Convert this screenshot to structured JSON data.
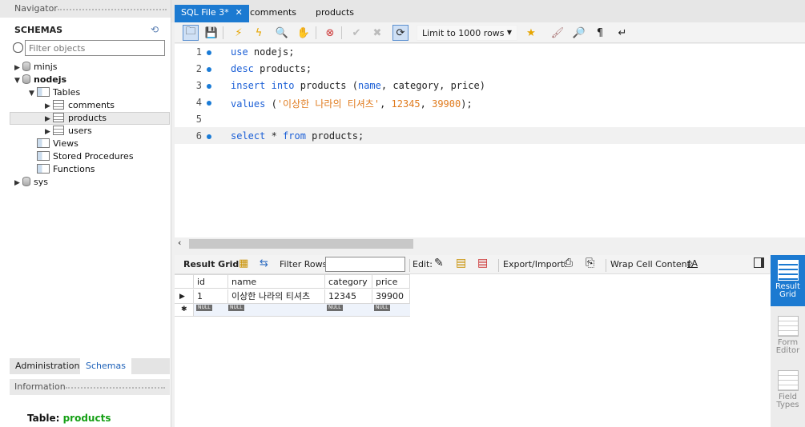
{
  "navigator": {
    "title": "Navigator",
    "schemas_title": "SCHEMAS",
    "filter_placeholder": "Filter objects",
    "tree": {
      "minjs": "minjs",
      "nodejs": "nodejs",
      "tables": "Tables",
      "comments": "comments",
      "products": "products",
      "users": "users",
      "views": "Views",
      "stored_procedures": "Stored Procedures",
      "functions": "Functions",
      "sys": "sys"
    },
    "bottom_tabs": [
      "Administration",
      "Schemas"
    ],
    "information_title": "Information",
    "table_label_prefix": "Table:",
    "table_label_name": "products"
  },
  "tabs": [
    "SQL File 3*",
    "comments",
    "products"
  ],
  "toolbar": {
    "limit": "Limit to 1000 rows"
  },
  "editor": {
    "lines": [
      {
        "n": "1",
        "code": [
          {
            "t": "use",
            "c": "kw"
          },
          {
            "t": " nodejs;",
            "c": ""
          }
        ]
      },
      {
        "n": "2",
        "code": [
          {
            "t": "desc",
            "c": "kw"
          },
          {
            "t": " products;",
            "c": ""
          }
        ]
      },
      {
        "n": "3",
        "code": [
          {
            "t": "insert",
            "c": "kw"
          },
          {
            "t": " ",
            "c": ""
          },
          {
            "t": "into",
            "c": "kw"
          },
          {
            "t": " products (",
            "c": ""
          },
          {
            "t": "name",
            "c": "kw"
          },
          {
            "t": ", category, price)",
            "c": ""
          }
        ]
      },
      {
        "n": "4",
        "code": [
          {
            "t": "values",
            "c": "kw"
          },
          {
            "t": " (",
            "c": ""
          },
          {
            "t": "'이상한 나라의 티셔츠'",
            "c": "str"
          },
          {
            "t": ", ",
            "c": ""
          },
          {
            "t": "12345",
            "c": "str"
          },
          {
            "t": ", ",
            "c": ""
          },
          {
            "t": "39900",
            "c": "str"
          },
          {
            "t": ");",
            "c": ""
          }
        ]
      },
      {
        "n": "5",
        "code": []
      },
      {
        "n": "6",
        "code": [
          {
            "t": "select",
            "c": "kw"
          },
          {
            "t": " * ",
            "c": ""
          },
          {
            "t": "from",
            "c": "kw"
          },
          {
            "t": " products;",
            "c": ""
          }
        ]
      }
    ]
  },
  "result_toolbar": {
    "result_grid": "Result Grid",
    "filter_rows": "Filter Rows:",
    "edit": "Edit:",
    "export_import": "Export/Import:",
    "wrap": "Wrap Cell Content:"
  },
  "grid": {
    "columns": [
      "id",
      "name",
      "category",
      "price"
    ],
    "rows": [
      [
        "1",
        "이상한 나라의 티셔츠",
        "12345",
        "39900"
      ]
    ],
    "null_label": "NULL"
  },
  "side_panel": [
    "Result Grid",
    "Form Editor",
    "Field Types"
  ],
  "colors": {
    "accent": "#1c7ad1",
    "keyword": "#1b5fd6",
    "string": "#e07b1e",
    "table_name": "#16a016"
  }
}
